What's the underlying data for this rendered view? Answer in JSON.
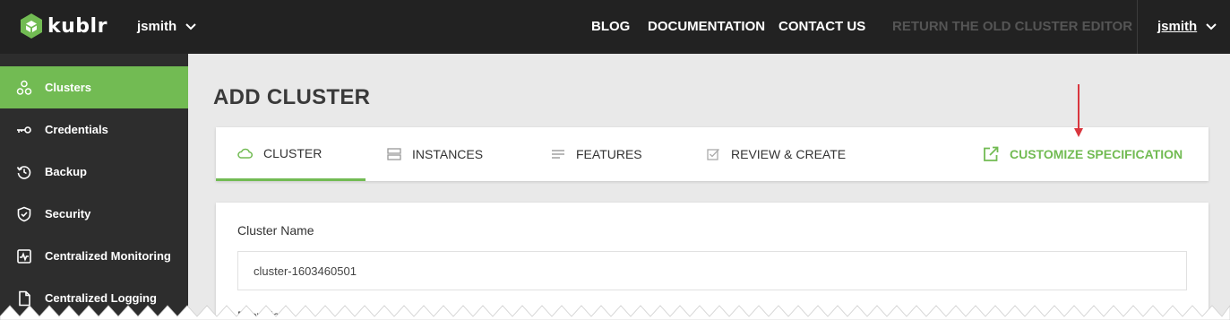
{
  "topbar": {
    "brand": "kublr",
    "org": "jsmith",
    "nav": [
      "BLOG",
      "DOCUMENTATION",
      "CONTACT US"
    ],
    "return_link": "RETURN THE OLD CLUSTER EDITOR",
    "user": "jsmith"
  },
  "sidebar": {
    "items": [
      {
        "label": "Clusters",
        "icon": "clusters-icon",
        "active": true
      },
      {
        "label": "Credentials",
        "icon": "key-icon"
      },
      {
        "label": "Backup",
        "icon": "backup-icon"
      },
      {
        "label": "Security",
        "icon": "shield-icon"
      },
      {
        "label": "Centralized Monitoring",
        "icon": "monitoring-icon"
      },
      {
        "label": "Centralized Logging",
        "icon": "document-icon"
      }
    ]
  },
  "page": {
    "title": "ADD CLUSTER",
    "tabs": [
      {
        "label": "CLUSTER",
        "icon": "cloud-icon",
        "active": true
      },
      {
        "label": "INSTANCES",
        "icon": "server-icon"
      },
      {
        "label": "FEATURES",
        "icon": "list-icon"
      },
      {
        "label": "REVIEW & CREATE",
        "icon": "checkbox-icon"
      }
    ],
    "customize": "CUSTOMIZE SPECIFICATION"
  },
  "form": {
    "cluster_name_label": "Cluster Name",
    "cluster_name_value": "cluster-1603460501",
    "next_label": "Provider"
  },
  "colors": {
    "accent": "#72bb53",
    "topbar": "#222222",
    "sidebar": "#2d2d2d",
    "annotation_arrow": "#d9363e"
  }
}
